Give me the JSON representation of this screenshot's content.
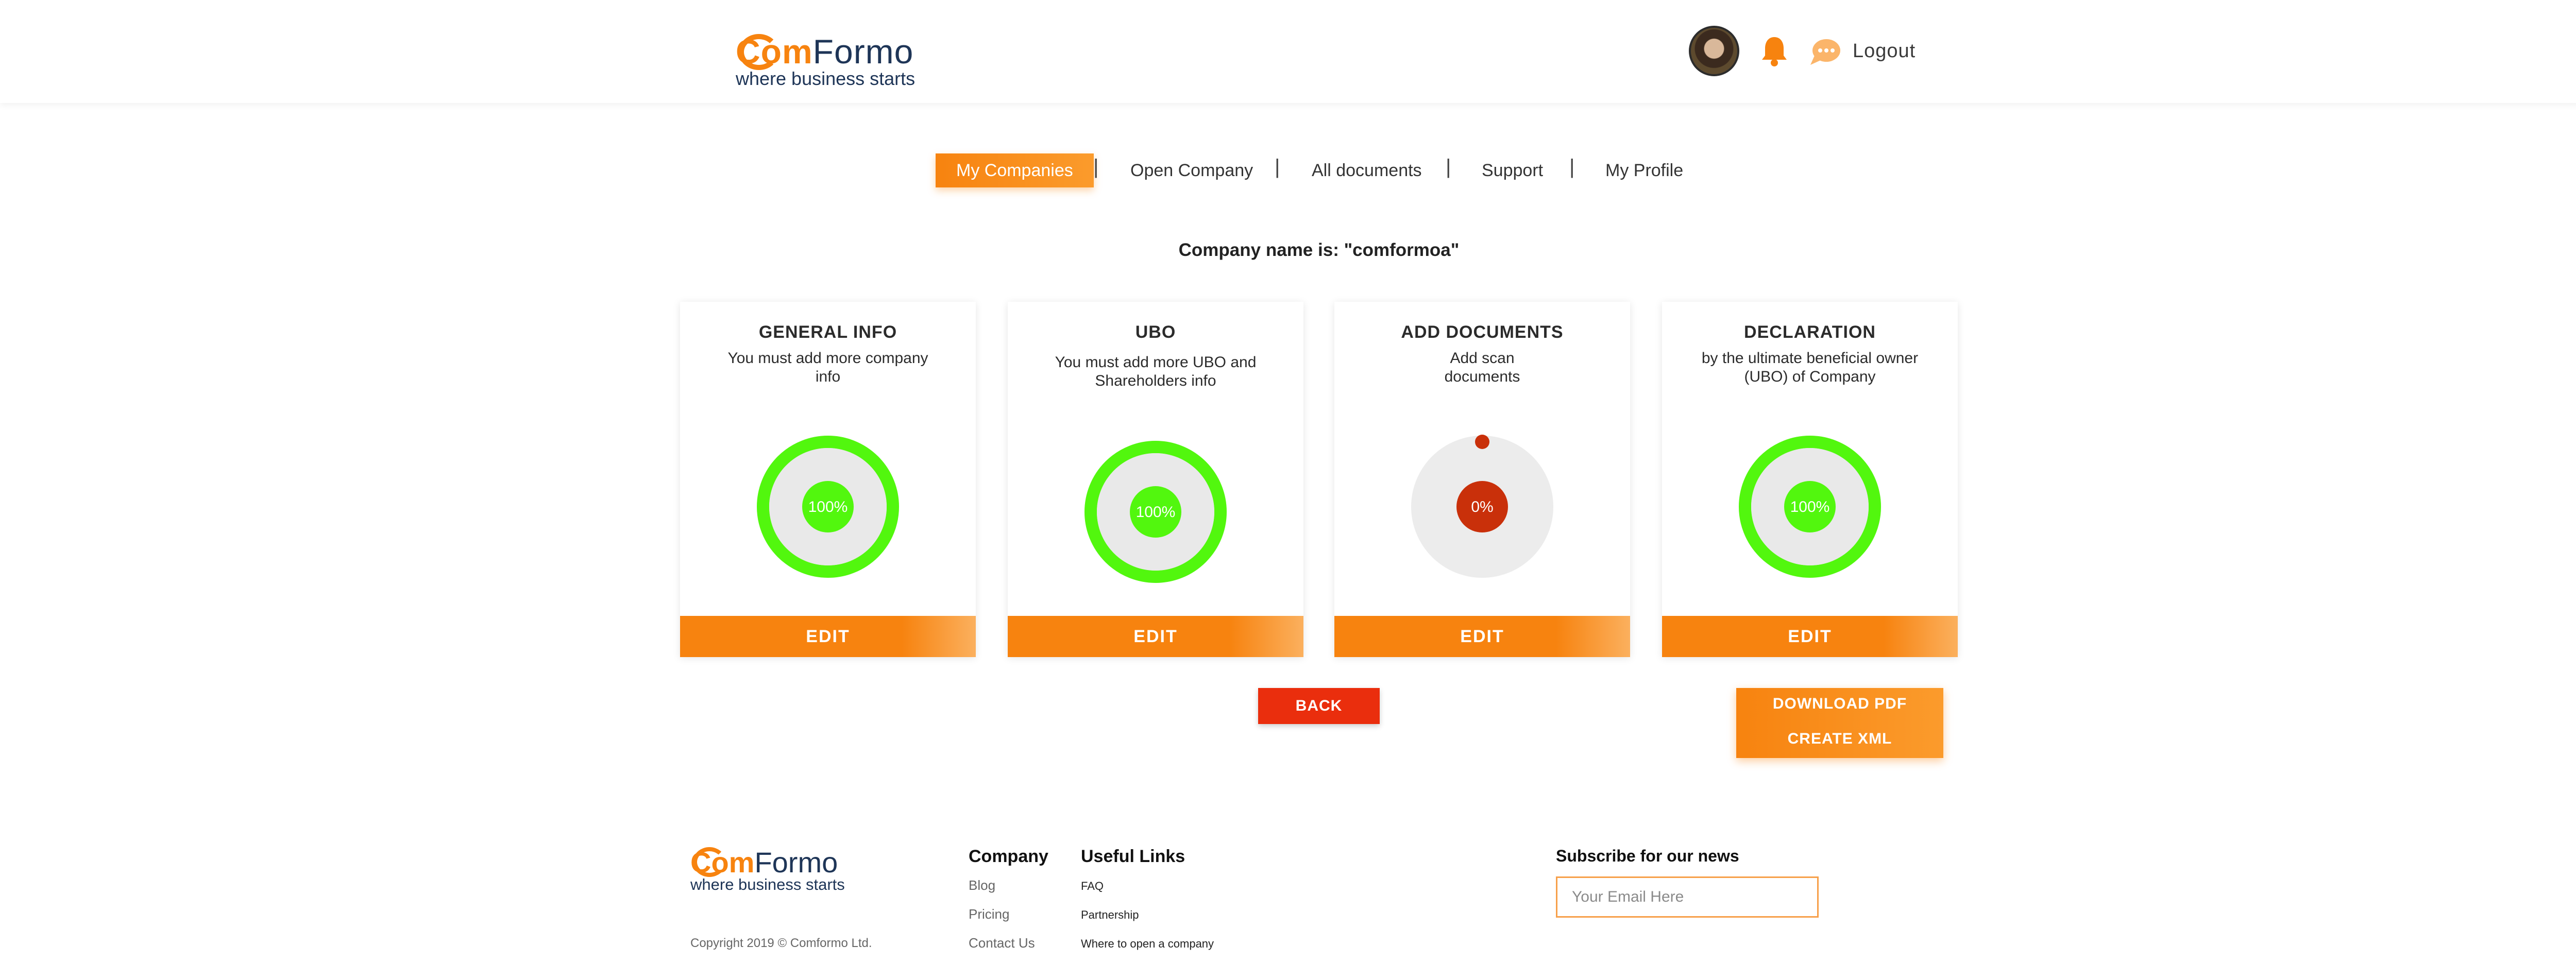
{
  "brand": {
    "logo_com": "Com",
    "logo_formo": "Formo",
    "tagline": "where business starts",
    "accent_color": "#f7830f",
    "navy_color": "#1e3557"
  },
  "header": {
    "avatar_icon": "user-avatar",
    "bell_icon": "bell-icon",
    "chat_icon": "chat-icon",
    "logout_label": "Logout"
  },
  "nav": {
    "items": [
      {
        "label": "My Companies",
        "active": true
      },
      {
        "label": "Open Company",
        "active": false
      },
      {
        "label": "All documents",
        "active": false
      },
      {
        "label": "Support",
        "active": false
      },
      {
        "label": "My Profile",
        "active": false
      }
    ],
    "separator": "|"
  },
  "company_name": "Company name is: \"comformoa\"",
  "cards": [
    {
      "title": "GENERAL INFO",
      "desc": "You must add more company info",
      "percent_label": "100%",
      "progress": 1.0,
      "edit_label": "EDIT",
      "color": "#52f70e"
    },
    {
      "title": "UBO",
      "desc": "You must add more UBO and Shareholders info",
      "percent_label": "100%",
      "progress": 1.0,
      "edit_label": "EDIT",
      "color": "#52f70e"
    },
    {
      "title": "ADD DOCUMENTS",
      "desc": "Add scan documents",
      "percent_label": "0%",
      "progress": 0.0,
      "edit_label": "EDIT",
      "color": "#c9300a"
    },
    {
      "title": "DECLARATION",
      "desc": "by the ultimate beneficial owner (UBO) of Company",
      "percent_label": "100%",
      "progress": 1.0,
      "edit_label": "EDIT",
      "color": "#52f70e"
    }
  ],
  "actions": {
    "back_label": "BACK",
    "download_pdf_label": "DOWNLOAD PDF",
    "create_xml_label": "CREATE XML"
  },
  "footer": {
    "copyright": "Copyright 2019 © Comformo Ltd.",
    "company_heading": "Company",
    "company_links": [
      "Blog",
      "Pricing",
      "Contact Us"
    ],
    "useful_heading": "Useful Links",
    "useful_links": [
      "FAQ",
      "Partnership",
      "Where to open a company"
    ],
    "subscribe_heading": "Subscribe for our news",
    "email_placeholder": "Your Email Here"
  }
}
